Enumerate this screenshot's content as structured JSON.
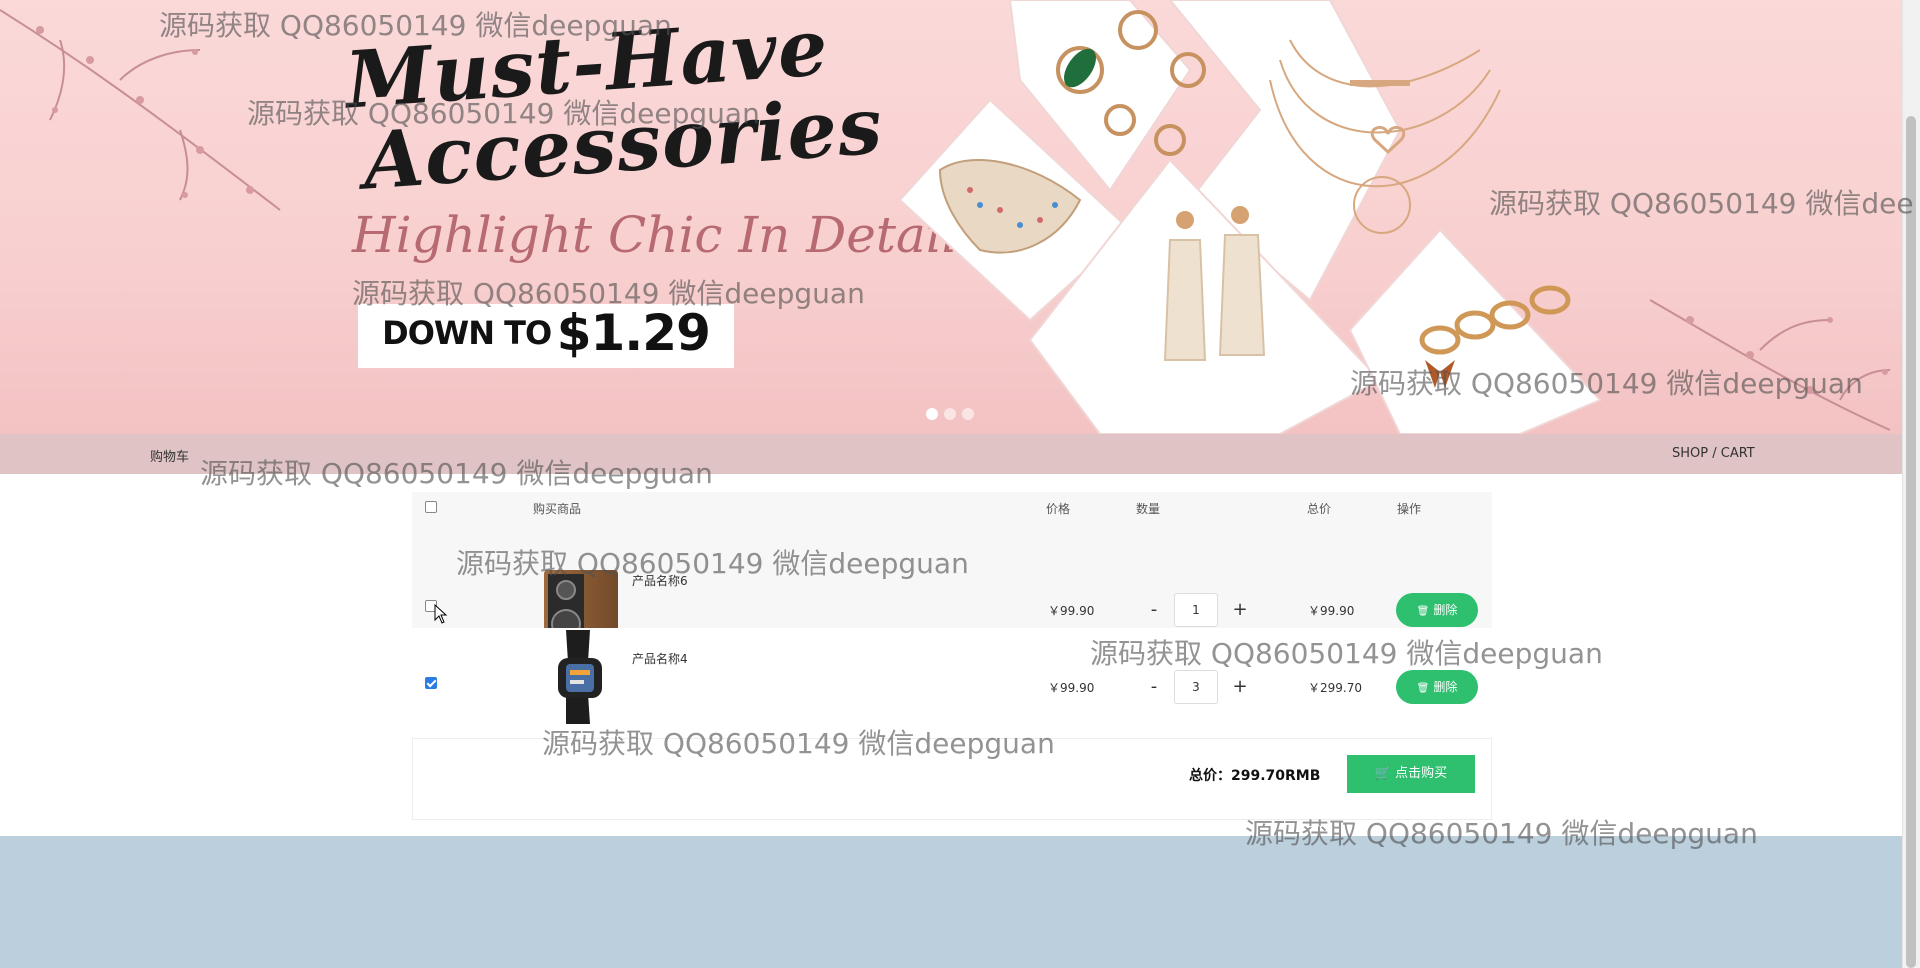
{
  "banner": {
    "headline_line1": "Must-Have",
    "headline_line2": "Accessories",
    "subline": "Highlight Chic In Details",
    "price_prefix": "DOWN TO",
    "price_value": "$1.29",
    "slide_count": 3,
    "active_slide": 1
  },
  "nav": {
    "title": "购物车",
    "breadcrumb": "SHOP / CART"
  },
  "cart": {
    "headers": {
      "product": "购买商品",
      "price": "价格",
      "quantity": "数量",
      "total": "总价",
      "action": "操作"
    },
    "select_all_checked": false,
    "items": [
      {
        "name": "产品名称6",
        "price": "￥99.90",
        "qty_minus": "-",
        "quantity": "1",
        "qty_plus": "+",
        "subtotal": "￥99.90",
        "delete_label": "删除",
        "checked": false
      },
      {
        "name": "产品名称4",
        "price": "￥99.90",
        "qty_minus": "-",
        "quantity": "3",
        "qty_plus": "+",
        "subtotal": "￥299.70",
        "delete_label": "删除",
        "checked": true
      }
    ],
    "total_label": "总价：299.70RMB",
    "buy_label": "点击购买"
  },
  "watermark_text": "源码获取 QQ86050149 微信deepguan",
  "watermark_text_cut": "源码获取 QQ86050149 微信dee",
  "colors": {
    "banner_bg": "#f8cfcf",
    "nav_bg": "#e0c4c5",
    "accent_green": "#2ebf6f",
    "bottom_bg": "#bccfdd"
  },
  "icons": {
    "delete": "trash-icon",
    "buy": "cart-icon"
  }
}
